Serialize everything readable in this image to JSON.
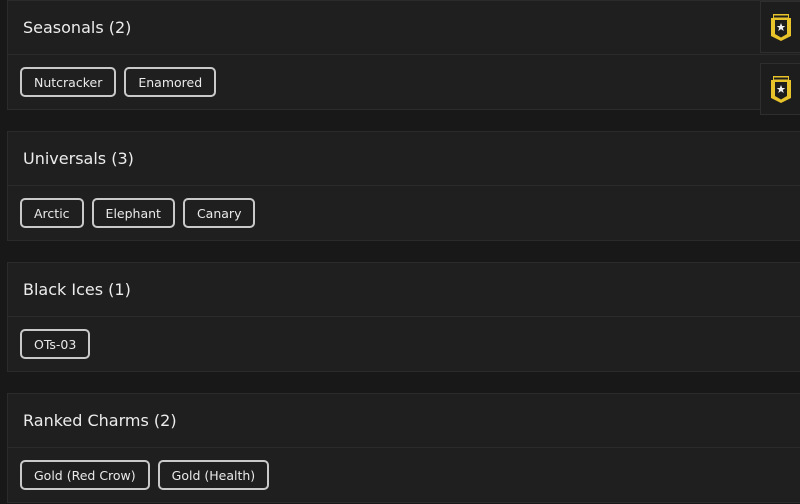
{
  "sections": [
    {
      "title": "Seasonals (2)",
      "tags": [
        "Nutcracker",
        "Enamored"
      ]
    },
    {
      "title": "Universals (3)",
      "tags": [
        "Arctic",
        "Elephant",
        "Canary"
      ]
    },
    {
      "title": "Black Ices (1)",
      "tags": [
        "OTs-03"
      ]
    },
    {
      "title": "Ranked Charms (2)",
      "tags": [
        "Gold (Red Crow)",
        "Gold (Health)"
      ]
    }
  ],
  "side_badges": [
    {
      "icon": "rank-badge-icon",
      "color": "#e8c32a"
    },
    {
      "icon": "rank-badge-icon",
      "color": "#e8c32a"
    }
  ]
}
